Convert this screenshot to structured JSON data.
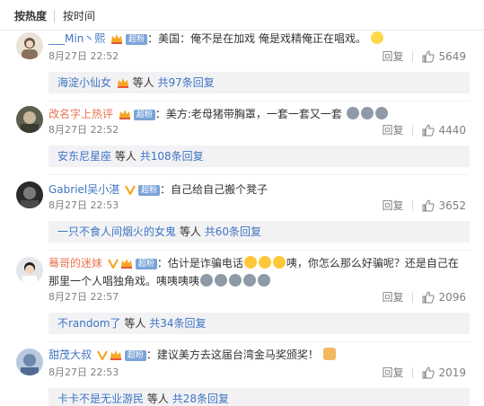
{
  "sort": {
    "hot_label": "按热度",
    "time_label": "按时间"
  },
  "vip_label": "超粉",
  "actions": {
    "reply_label": "回复"
  },
  "reply_prefix": "等人",
  "comments": [
    {
      "user": "___Min丶熙",
      "text": "美国：俺不是在加戏 俺是戏精俺正在唱戏。",
      "time": "8月27日 22:52",
      "likes": "5649",
      "reply_user": "海淀小仙女",
      "reply_count": "共97条回复"
    },
    {
      "user": "改名字上热评",
      "text": "美方:老母猪带胸罩，一套一套又一套",
      "time": "8月27日 22:52",
      "likes": "4440",
      "reply_user": "安东尼星座",
      "reply_count": "共108条回复"
    },
    {
      "user": "Gabriel吴小湛",
      "text": "自己给自己搬个凳子",
      "time": "8月27日 22:53",
      "likes": "3652",
      "reply_user": "一只不食人间烟火的女鬼",
      "reply_count": "共60条回复"
    },
    {
      "user": "蓦哥的迷妹",
      "text_a": "估计是诈骗电话",
      "text_b": "咦，你怎么那么好骗呢？还是自己在",
      "text_c": "那里一个人唱独角戏。咦咦咦咦",
      "time": "8月27日 22:57",
      "likes": "2096",
      "reply_user": "不random了",
      "reply_count": "共34条回复"
    },
    {
      "user": "甜茂大叔",
      "text": "建议美方去这届台湾金马奖颁奖！",
      "time": "8月27日 22:53",
      "likes": "2019",
      "reply_user": "卡卡不是无业游民",
      "reply_count": "共28条回复"
    }
  ]
}
